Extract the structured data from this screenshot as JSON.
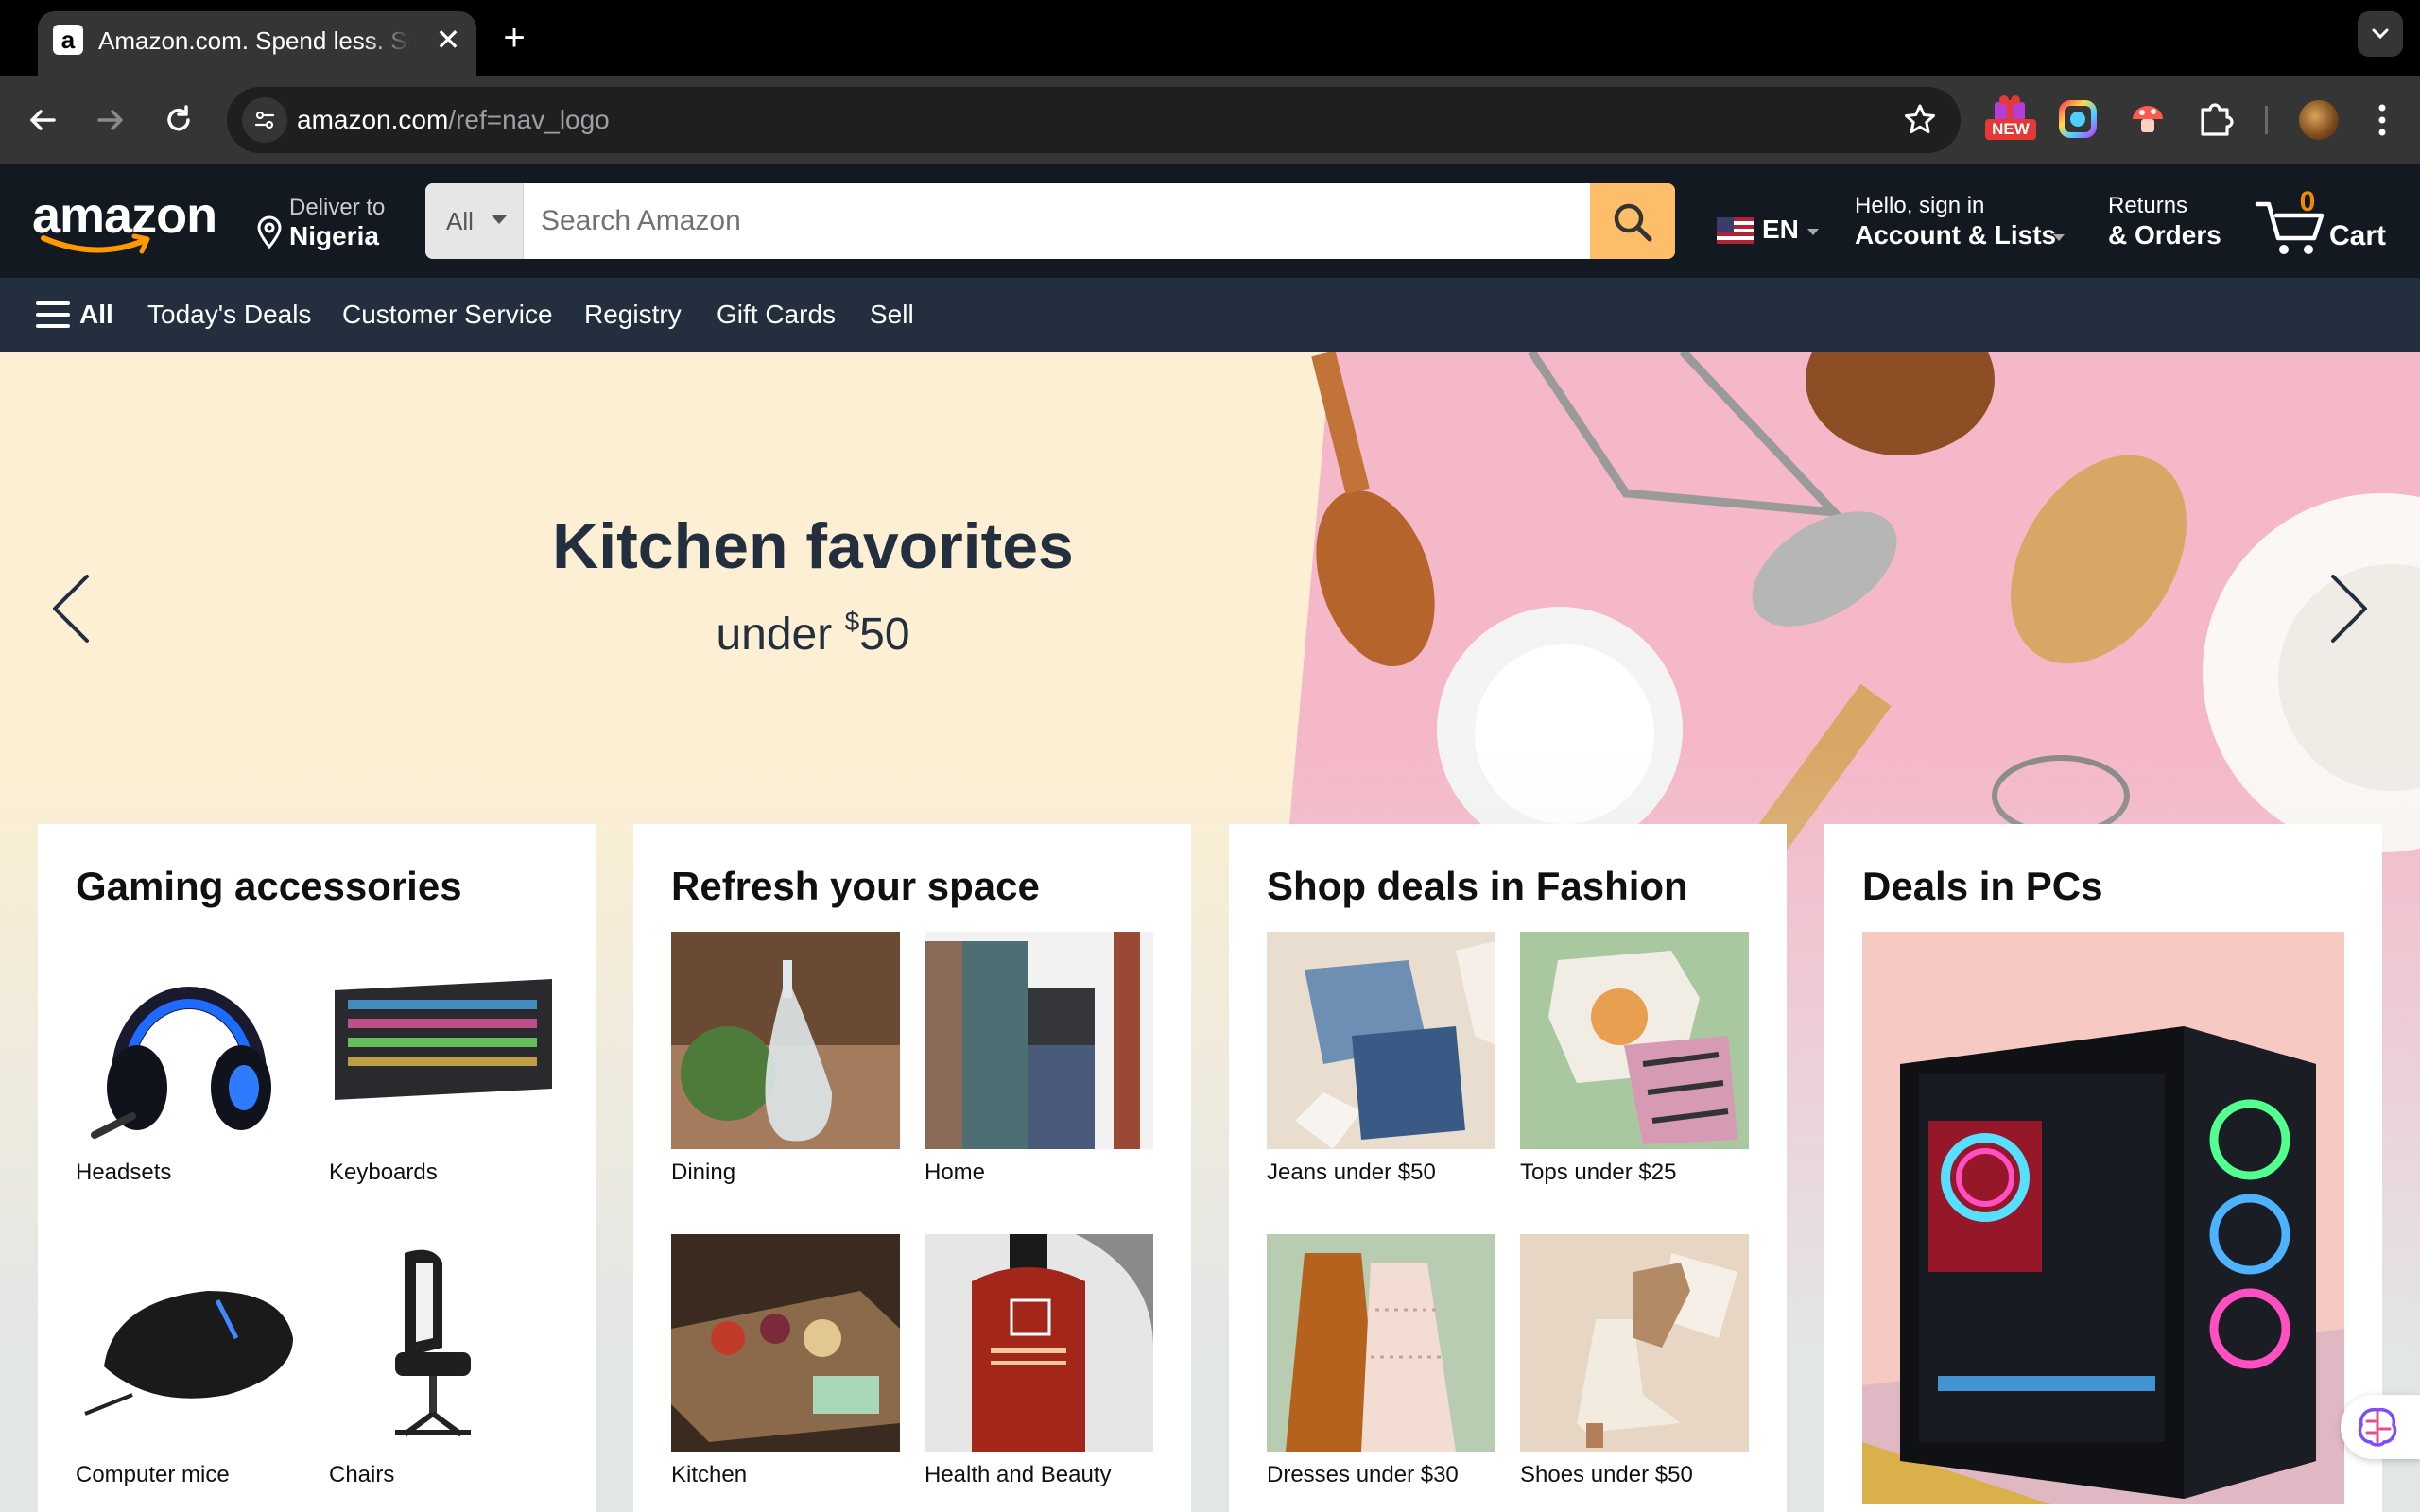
{
  "browser": {
    "tab_title": "Amazon.com. Spend less. Smile more.",
    "tab_close": "✕",
    "new_tab": "+",
    "url_host": "amazon.com",
    "url_path": "/ref=nav_logo",
    "ext_badge": "NEW"
  },
  "header": {
    "logo": "amazon",
    "deliver_to": "Deliver to",
    "location": "Nigeria",
    "search_category": "All",
    "search_placeholder": "Search Amazon",
    "language": "EN",
    "greeting": "Hello, sign in",
    "account_label": "Account & Lists",
    "returns": "Returns",
    "orders": "& Orders",
    "cart_count": "0",
    "cart_label": "Cart"
  },
  "nav": {
    "all_label": "All",
    "links": [
      "Today's Deals",
      "Customer Service",
      "Registry",
      "Gift Cards",
      "Sell"
    ]
  },
  "hero": {
    "title": "Kitchen favorites",
    "subtitle_prefix": "under ",
    "subtitle_currency": "$",
    "subtitle_amount": "50"
  },
  "cards": [
    {
      "title": "Gaming accessories",
      "tiles": [
        "Headsets",
        "Keyboards",
        "Computer mice",
        "Chairs"
      ]
    },
    {
      "title": "Refresh your space",
      "tiles": [
        "Dining",
        "Home",
        "Kitchen",
        "Health and Beauty"
      ]
    },
    {
      "title": "Shop deals in Fashion",
      "tiles": [
        "Jeans under $50",
        "Tops under $25",
        "Dresses under $30",
        "Shoes under $50"
      ]
    },
    {
      "title": "Deals in PCs"
    }
  ],
  "colors": {
    "nav_belt": "#131921",
    "nav_main": "#232f3e",
    "search_button": "#febd69",
    "cart_count": "#f08804",
    "hero_left": "#fcefd3",
    "hero_right": "#f5b8c8"
  }
}
